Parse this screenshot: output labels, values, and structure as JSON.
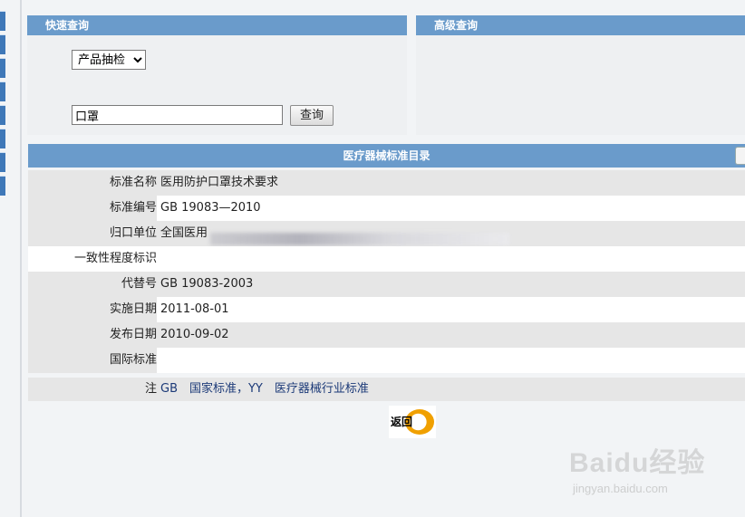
{
  "quick_search": {
    "title": "快速查询",
    "type_select": {
      "selected": "产品抽检",
      "options": [
        "产品抽检"
      ]
    },
    "keyword": "口罩",
    "search_button": "查询"
  },
  "advanced_search": {
    "title": "高级查询"
  },
  "catalog": {
    "title": "医疗器械标准目录",
    "rows": [
      {
        "label": "标准名称",
        "value": "医用防护口罩技术要求"
      },
      {
        "label": "标准编号",
        "value": "GB 19083—2010"
      },
      {
        "label": "归口单位",
        "value": "全国医用"
      },
      {
        "label": "一致性程度标识",
        "value": ""
      },
      {
        "label": "代替号",
        "value": "GB 19083-2003"
      },
      {
        "label": "实施日期",
        "value": "2011-08-01"
      },
      {
        "label": "发布日期",
        "value": "2010-09-02"
      },
      {
        "label": "国际标准",
        "value": ""
      }
    ],
    "note": {
      "label": "注",
      "value": "GB　国家标准，YY　医疗器械行业标准"
    },
    "back_button": "返回"
  },
  "watermark": {
    "brand": "Baidu经验",
    "url": "jingyan.baidu.com"
  }
}
